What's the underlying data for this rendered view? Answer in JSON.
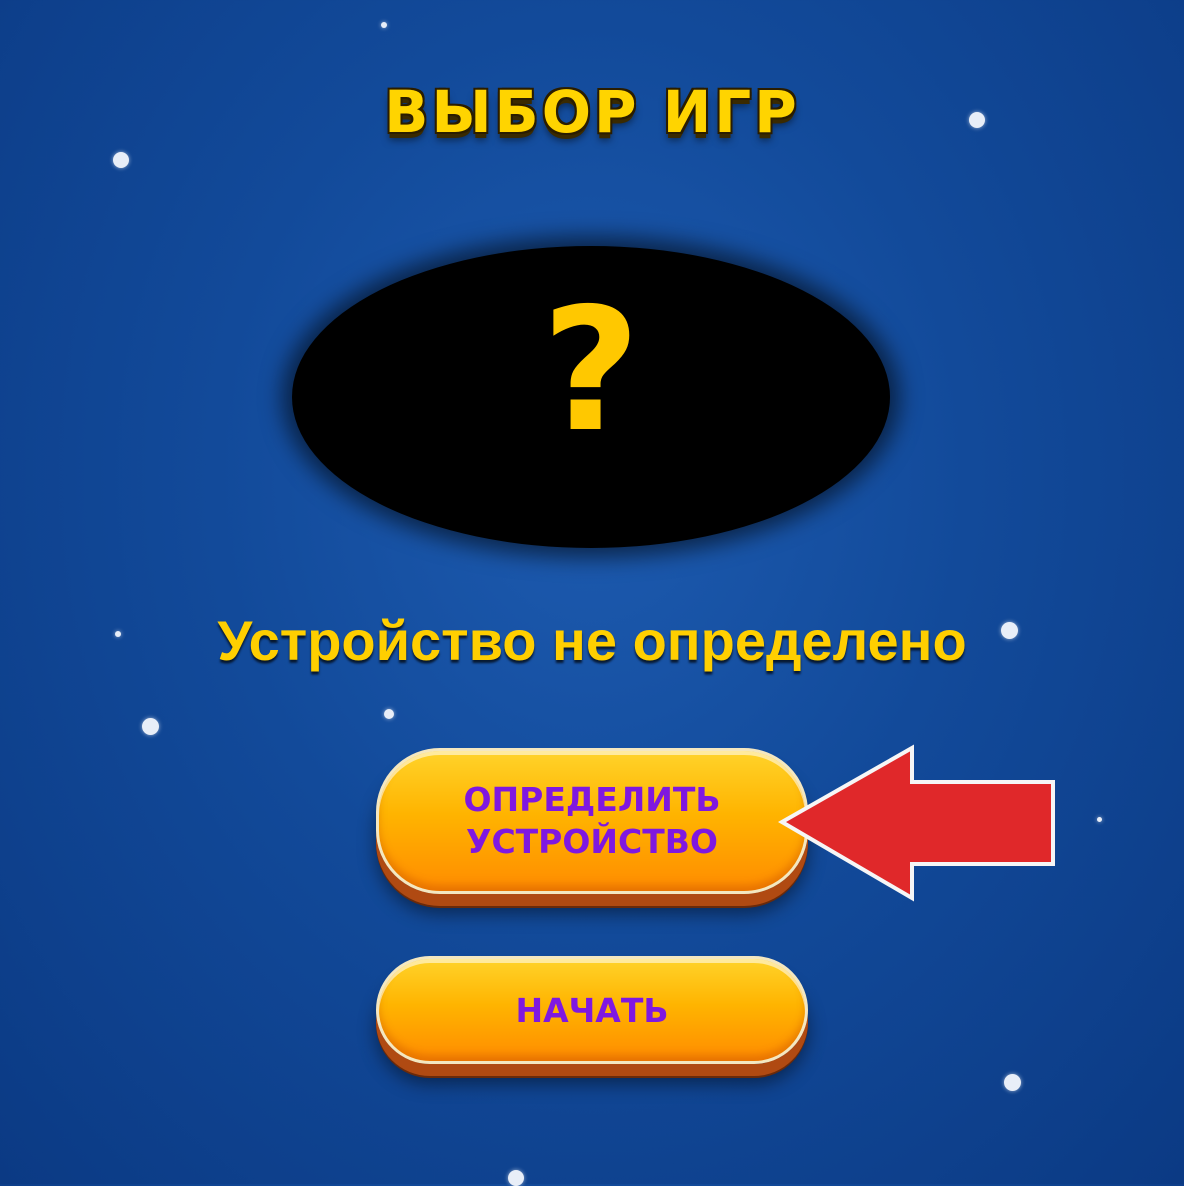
{
  "title": "ВЫБОР ИГР",
  "placeholder_icon": "question-mark-icon",
  "placeholder_symbol": "?",
  "status_text": "Устройство не определено",
  "buttons": {
    "detect_device": {
      "line1": "ОПРЕДЕЛИТЬ",
      "line2": "УСТРОЙСТВО"
    },
    "start": {
      "label": "НАЧАТЬ"
    }
  },
  "colors": {
    "background": "#124a9a",
    "title": "#ffd400",
    "status_text": "#ffcf00",
    "button_fill": "#ffb400",
    "button_text": "#7f18e0",
    "arrow": "#e0282a"
  }
}
